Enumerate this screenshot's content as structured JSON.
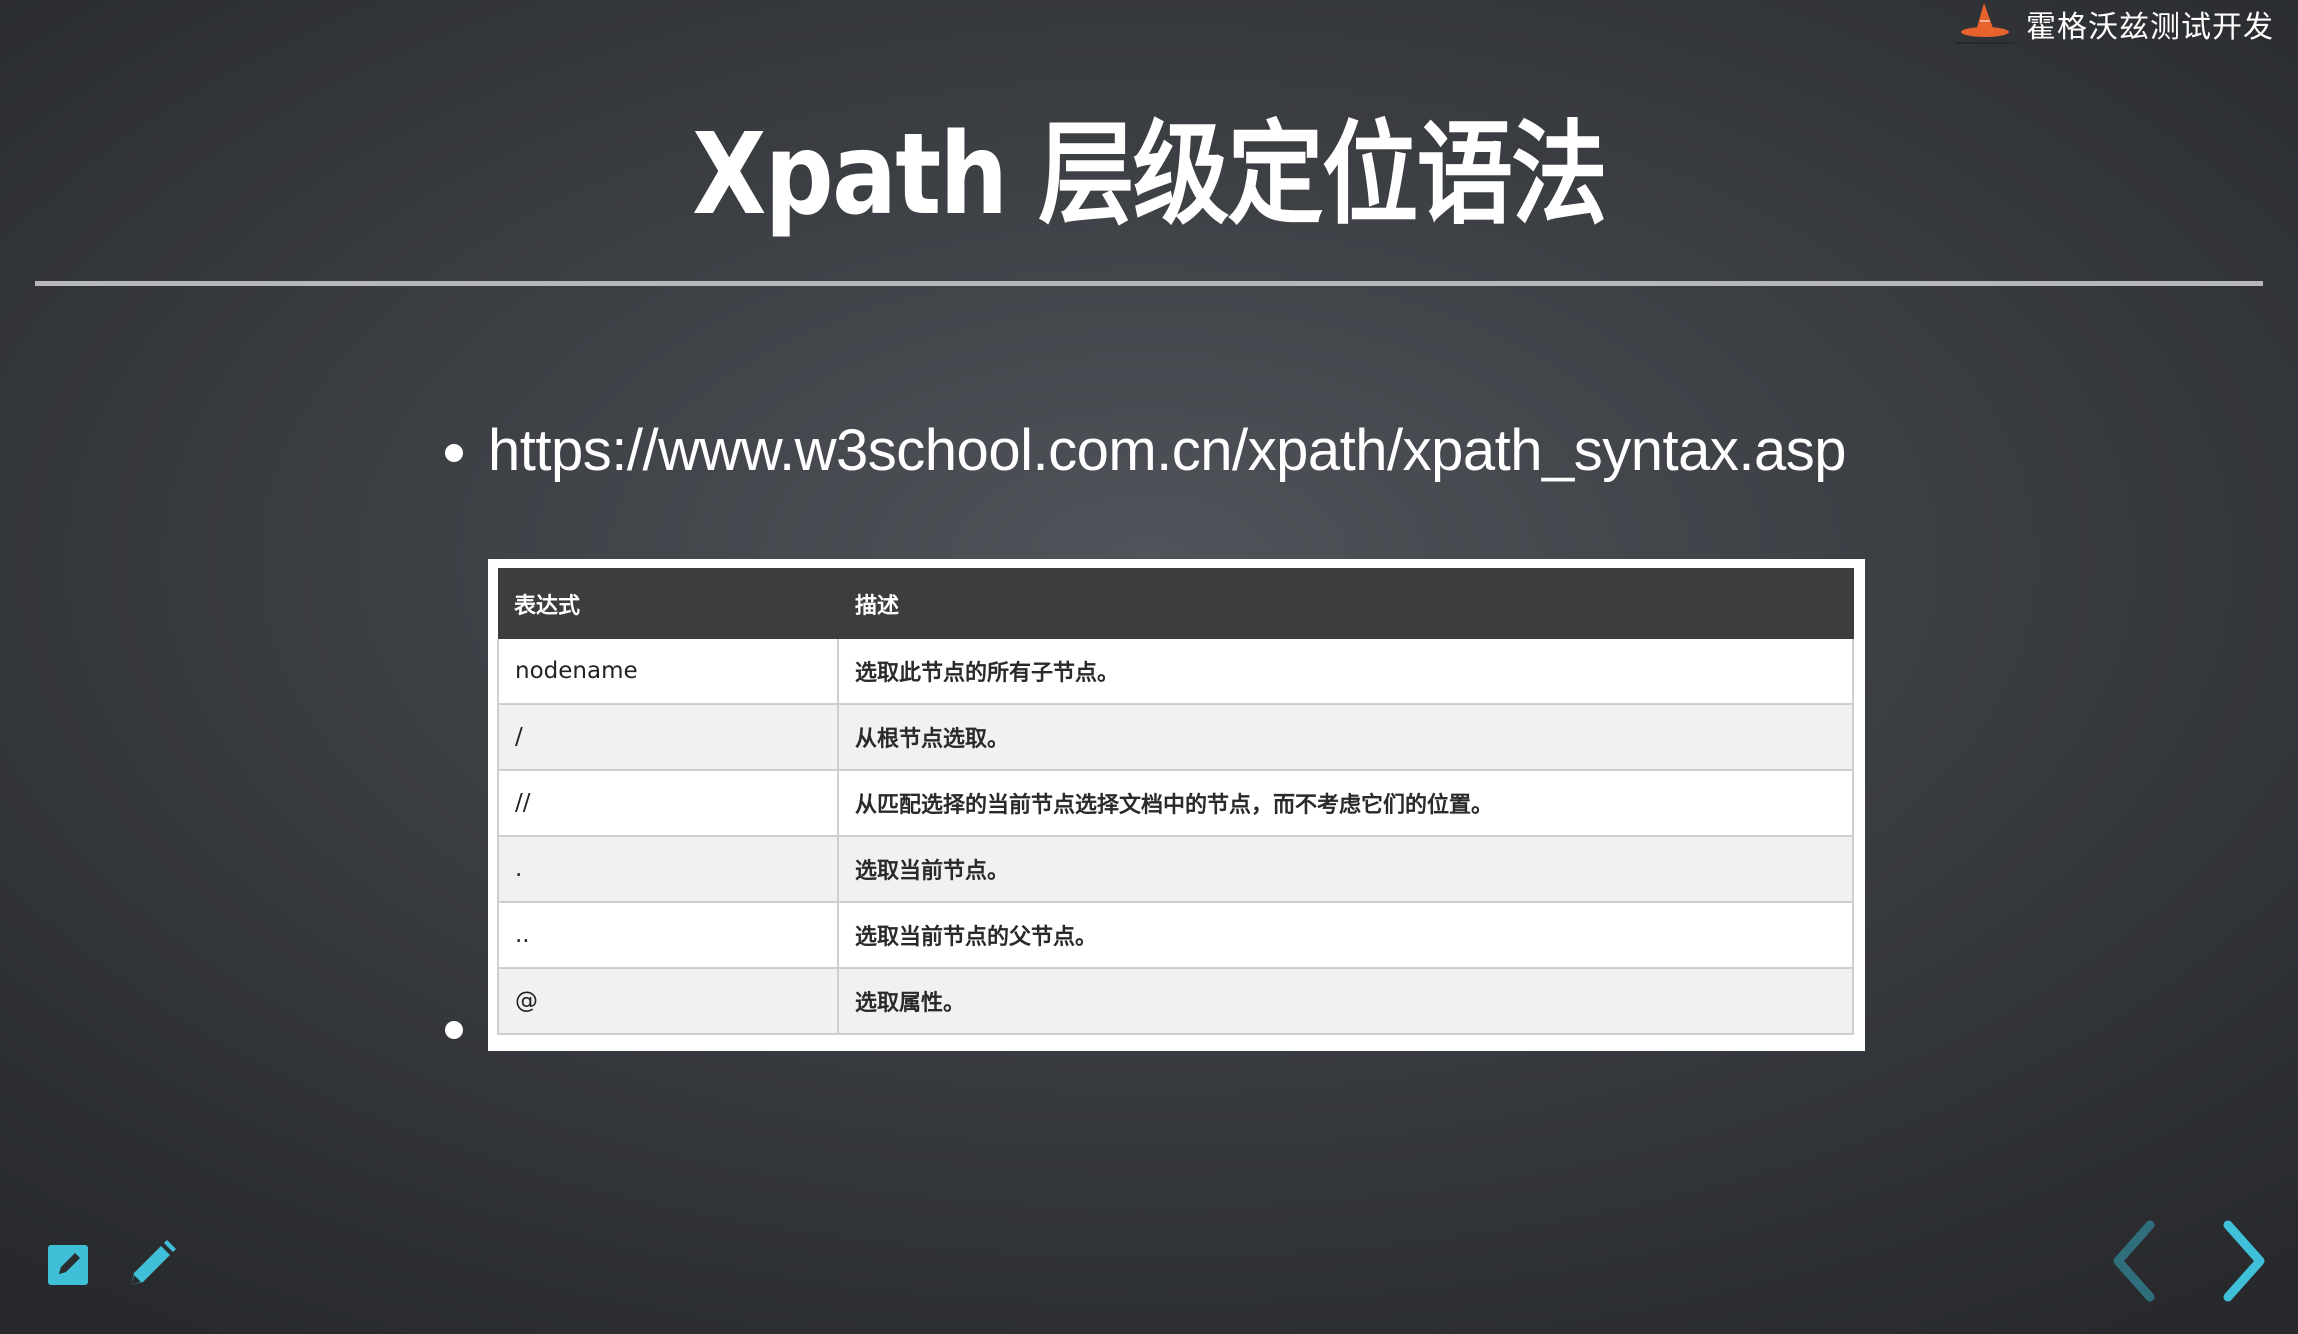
{
  "brand": {
    "name": "霍格沃兹测试开发",
    "logo_icon": "wizard-hat-logo-icon"
  },
  "slide": {
    "title": "Xpath 层级定位语法",
    "bullets": [
      {
        "text": "https://www.w3school.com.cn/xpath/xpath_syntax.asp",
        "type": "link"
      },
      {
        "text": "",
        "type": "image-table"
      }
    ]
  },
  "syntax_table": {
    "headers": [
      "表达式",
      "描述"
    ],
    "rows": [
      [
        "nodename",
        "选取此节点的所有子节点。"
      ],
      [
        "/",
        "从根节点选取。"
      ],
      [
        "//",
        "从匹配选择的当前节点选择文档中的节点，而不考虑它们的位置。"
      ],
      [
        ".",
        "选取当前节点。"
      ],
      [
        "..",
        "选取当前节点的父节点。"
      ],
      [
        "@",
        "选取属性。"
      ]
    ]
  },
  "controls": {
    "tools": [
      "edit-slide-icon",
      "pencil-icon"
    ],
    "navigation": [
      "chevron-left-icon",
      "chevron-right-icon"
    ],
    "accent_color": "#3fc0d8",
    "disabled_color": "#2f6f7c"
  }
}
